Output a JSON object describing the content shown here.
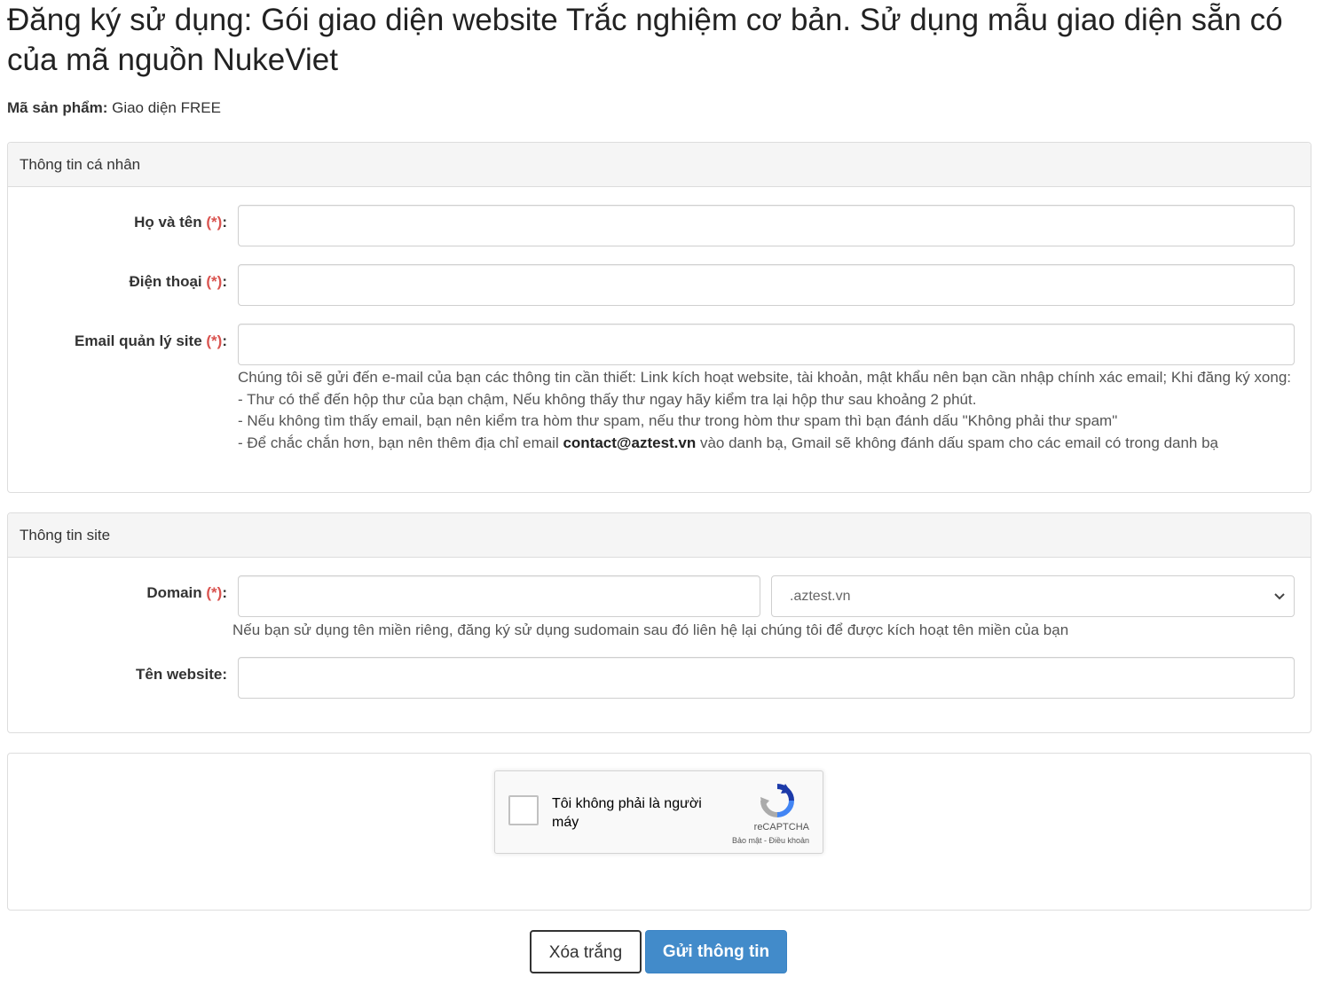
{
  "title": "Đăng ký sử dụng: Gói giao diện website Trắc nghiệm cơ bản. Sử dụng mẫu giao diện sẵn có của mã nguồn NukeViet",
  "product": {
    "label": "Mã sản phẩm:",
    "value": "Giao diện FREE"
  },
  "required_mark": "(*)",
  "personal": {
    "heading": "Thông tin cá nhân",
    "fullname_label": "Họ và tên ",
    "phone_label": "Điện thoại ",
    "email_label": "Email quản lý site ",
    "colon": ":",
    "email_help_1": "Chúng tôi sẽ gửi đến e-mail của bạn các thông tin cần thiết: Link kích hoạt website, tài khoản, mật khẩu nên bạn cần nhập chính xác email; Khi đăng ký xong:",
    "email_help_2": "- Thư có thể đến hộp thư của bạn chậm, Nếu không thấy thư ngay hãy kiểm tra lại hộp thư sau khoảng 2 phút.",
    "email_help_3": "- Nếu không tìm thấy email, bạn nên kiểm tra hòm thư spam, nếu thư trong hòm thư spam thì bạn đánh dấu \"Không phải thư spam\"",
    "email_help_4_pre": "- Để chắc chắn hơn, bạn nên thêm địa chỉ email ",
    "email_help_4_email": "contact@aztest.vn",
    "email_help_4_post": " vào danh bạ, Gmail sẽ không đánh dấu spam cho các email có trong danh bạ"
  },
  "site": {
    "heading": "Thông tin site",
    "domain_label": "Domain ",
    "domain_suffix": ".aztest.vn",
    "domain_help": "Nếu bạn sử dụng tên miền riêng, đăng ký sử dụng sudomain sau đó liên hệ lại chúng tôi để được kích hoạt tên miền của bạn",
    "website_label": "Tên website:"
  },
  "captcha": {
    "text": "Tôi không phải là người máy",
    "brand": "reCAPTCHA",
    "links": "Bảo mật - Điều khoản"
  },
  "buttons": {
    "reset": "Xóa trắng",
    "submit": "Gửi thông tin"
  },
  "colors": {
    "accent": "#428bca",
    "required": "#d9534f",
    "panel_heading_bg": "#f5f5f5"
  }
}
